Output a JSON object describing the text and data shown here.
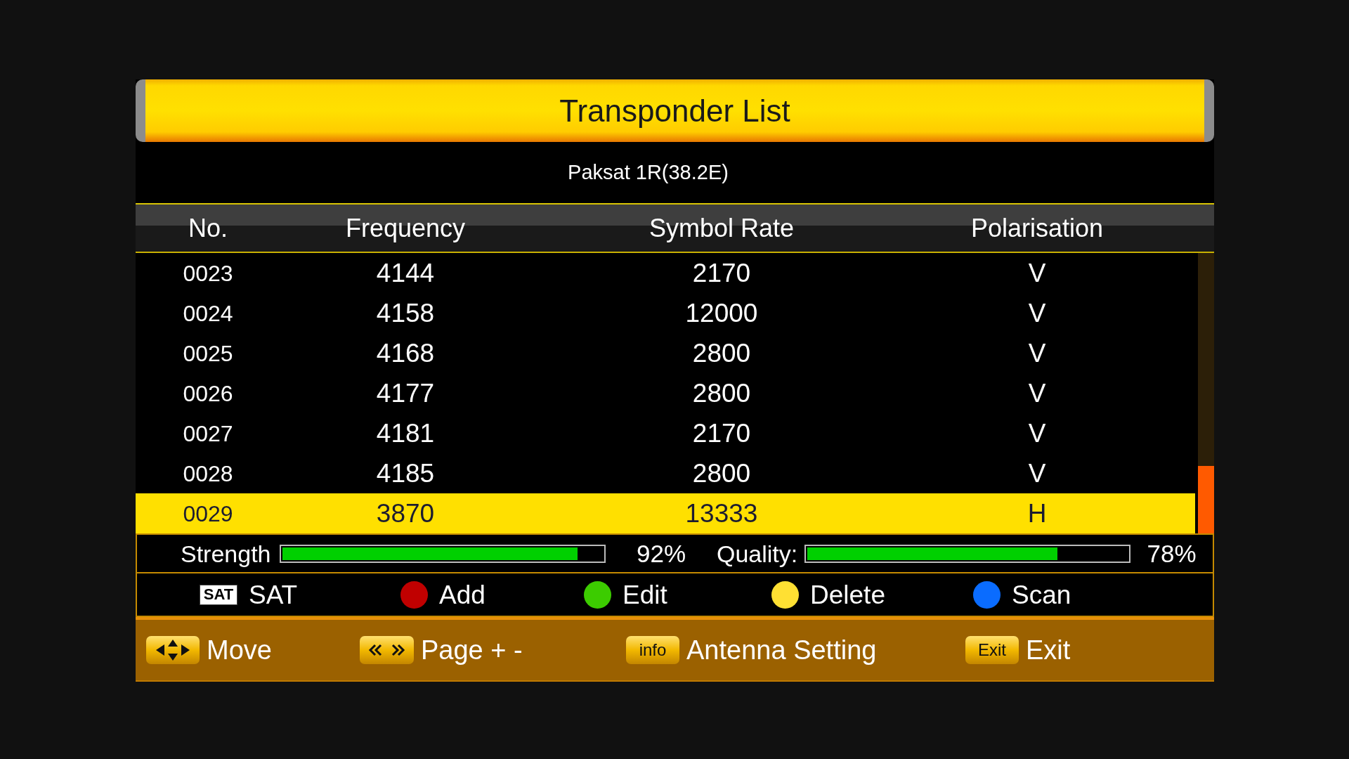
{
  "window": {
    "title": "Transponder List"
  },
  "satellite": "Paksat 1R(38.2E)",
  "table": {
    "columns": [
      "No.",
      "Frequency",
      "Symbol Rate",
      "Polarisation"
    ],
    "rows": [
      {
        "no": "0023",
        "frequency": "4144",
        "symbol_rate": "2170",
        "polarisation": "V",
        "selected": false
      },
      {
        "no": "0024",
        "frequency": "4158",
        "symbol_rate": "12000",
        "polarisation": "V",
        "selected": false
      },
      {
        "no": "0025",
        "frequency": "4168",
        "symbol_rate": "2800",
        "polarisation": "V",
        "selected": false
      },
      {
        "no": "0026",
        "frequency": "4177",
        "symbol_rate": "2800",
        "polarisation": "V",
        "selected": false
      },
      {
        "no": "0027",
        "frequency": "4181",
        "symbol_rate": "2170",
        "polarisation": "V",
        "selected": false
      },
      {
        "no": "0028",
        "frequency": "4185",
        "symbol_rate": "2800",
        "polarisation": "V",
        "selected": false
      },
      {
        "no": "0029",
        "frequency": "3870",
        "symbol_rate": "13333",
        "polarisation": "H",
        "selected": true
      }
    ]
  },
  "meters": [
    {
      "label": "Strength",
      "level": 0.92,
      "reading": "92%"
    },
    {
      "label": "Quality:",
      "level": 0.78,
      "reading": "78%"
    }
  ],
  "color_keys": [
    {
      "kind": "tag",
      "tag": "SAT",
      "label": "SAT"
    },
    {
      "kind": "dot",
      "color": "#c00000",
      "label": "Add"
    },
    {
      "kind": "dot",
      "color": "#3ccc00",
      "label": "Edit"
    },
    {
      "kind": "dot",
      "color": "#ffe033",
      "label": "Delete"
    },
    {
      "kind": "dot",
      "color": "#0a6cff",
      "label": "Scan"
    }
  ],
  "hints": [
    {
      "kind": "arrows",
      "label": "Move"
    },
    {
      "kind": "chevrons",
      "label": "Page + -"
    },
    {
      "kind": "key",
      "key": "info",
      "label": "Antenna Setting"
    },
    {
      "kind": "key",
      "key": "Exit",
      "label": "Exit"
    }
  ]
}
